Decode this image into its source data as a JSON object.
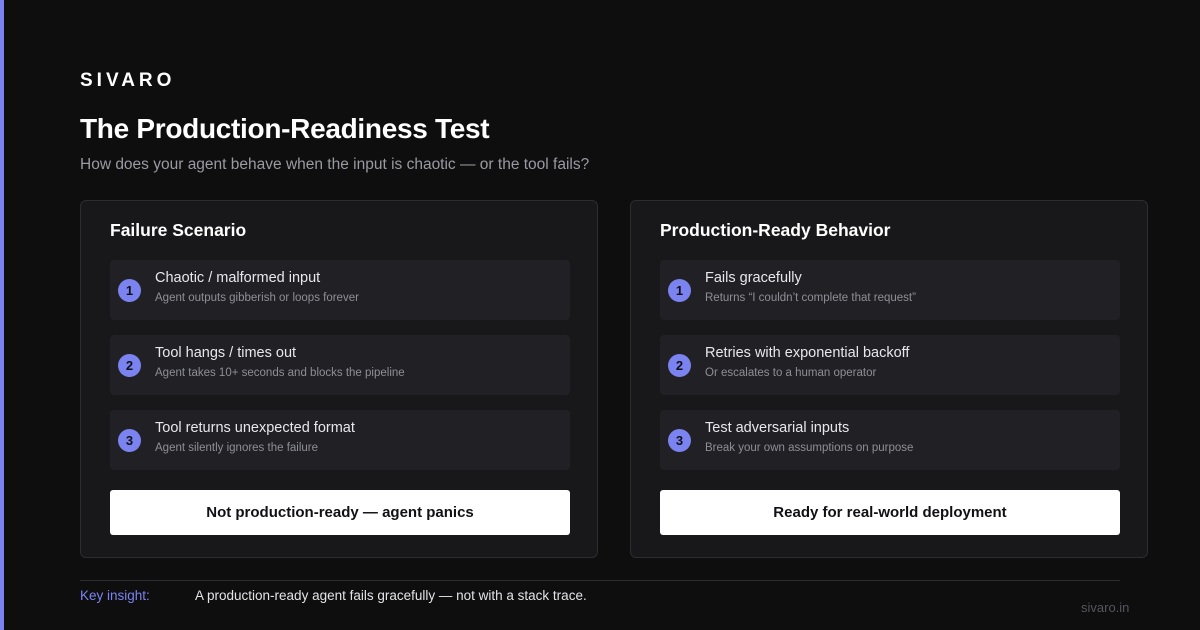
{
  "brand": "SIVARO",
  "title": "The Production-Readiness Test",
  "subtitle": "How does your agent behave when the input is chaotic — or the tool fails?",
  "colors": {
    "accent": "#7b83f0",
    "background": "#0e0e0f",
    "panel": "#18181b"
  },
  "left_panel": {
    "title": "Failure Scenario",
    "items": [
      {
        "num": "1",
        "title": "Chaotic / malformed input",
        "desc": "Agent outputs gibberish or loops forever"
      },
      {
        "num": "2",
        "title": "Tool hangs / times out",
        "desc": "Agent takes 10+ seconds and blocks the pipeline"
      },
      {
        "num": "3",
        "title": "Tool returns unexpected format",
        "desc": "Agent silently ignores the failure"
      }
    ],
    "verdict": "Not production-ready — agent panics"
  },
  "right_panel": {
    "title": "Production-Ready Behavior",
    "items": [
      {
        "num": "1",
        "title": "Fails gracefully",
        "desc": "Returns “I couldn’t complete that request”"
      },
      {
        "num": "2",
        "title": "Retries with exponential backoff",
        "desc": "Or escalates to a human operator"
      },
      {
        "num": "3",
        "title": "Test adversarial inputs",
        "desc": "Break your own assumptions on purpose"
      }
    ],
    "verdict": "Ready for real-world deployment"
  },
  "footer": {
    "label": "Key insight:",
    "text": "A production-ready agent fails gracefully — not with a stack trace.",
    "site": "sivaro.in"
  }
}
